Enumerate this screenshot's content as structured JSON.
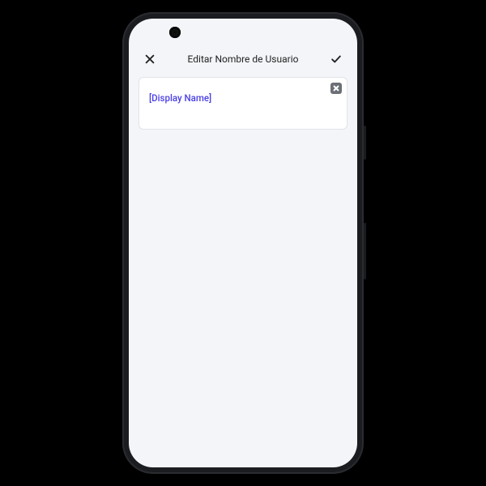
{
  "header": {
    "close_label": "Close",
    "title": "Editar Nombre de Usuario",
    "confirm_label": "Confirm"
  },
  "input": {
    "value": "[Display Name]",
    "clear_label": "Clear"
  },
  "icons": {
    "close": "close-icon",
    "confirm": "check-icon",
    "clear": "clear-input-icon"
  }
}
